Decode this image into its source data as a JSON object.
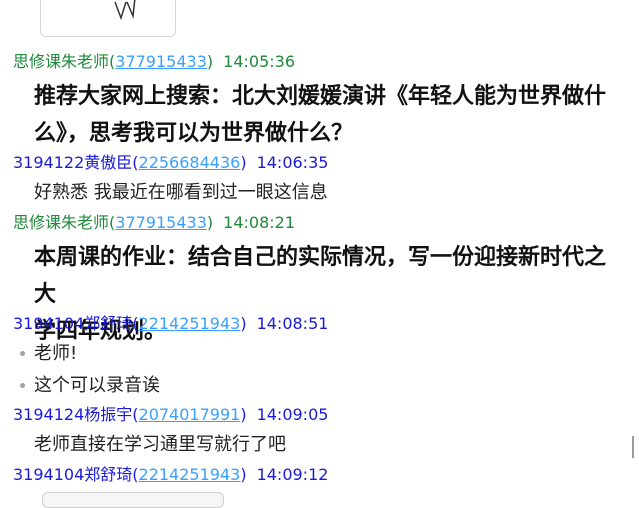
{
  "messages": [
    {
      "sender": "思修课朱老师",
      "qq": "377915433",
      "time": "14:05:36",
      "color": "#1e8a3a",
      "lines": [
        "推荐大家网上搜索：北大刘媛媛演讲《年轻人能为世界做什",
        "么》，思考我可以为世界做什么？"
      ]
    },
    {
      "sender": "3194122黄傲臣",
      "qq": "2256684436",
      "time": "14:06:35",
      "color": "#1a1adb",
      "lines": [
        "好熟悉 我最近在哪看到过一眼这信息"
      ]
    },
    {
      "sender": "思修课朱老师",
      "qq": "377915433",
      "time": "14:08:21",
      "color": "#1e8a3a",
      "lines": [
        "本周课的作业：结合自己的实际情况，写一份迎接新时代之大",
        "学四年规划。"
      ]
    },
    {
      "sender": "3194104郑舒琦",
      "qq": "2214251943",
      "time": "14:08:51",
      "color": "#1a1adb",
      "lines": [
        "老师!",
        "这个可以录音诶"
      ]
    },
    {
      "sender": "3194124杨振宇",
      "qq": "2074017991",
      "time": "14:09:05",
      "color": "#1a1adb",
      "lines": [
        "老师直接在学习通里写就行了吧"
      ]
    },
    {
      "sender": "3194104郑舒琦",
      "qq": "2214251943",
      "time": "14:09:12",
      "color": "#1a1adb",
      "lines": []
    }
  ]
}
